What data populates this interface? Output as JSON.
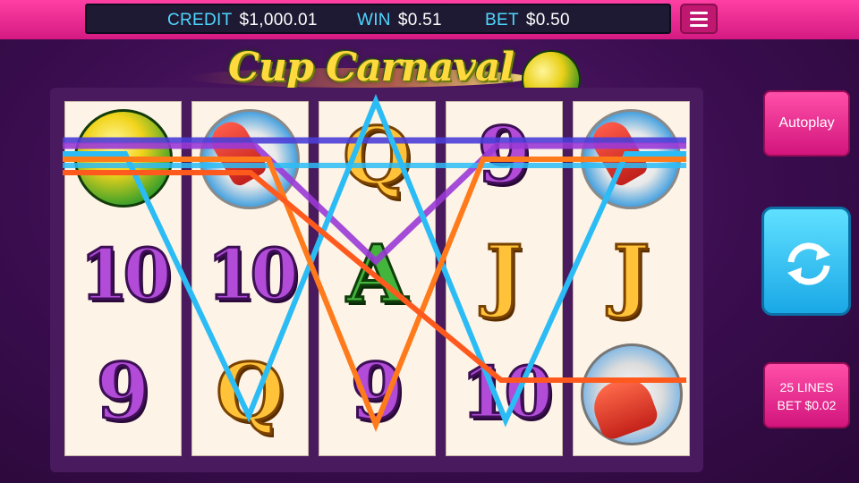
{
  "header": {
    "credit_label": "CREDIT",
    "credit_value": "$1,000.01",
    "win_label": "WIN",
    "win_value": "$0.51",
    "bet_label": "BET",
    "bet_value": "$0.50",
    "menu_icon": "hamburger-menu-icon"
  },
  "game": {
    "title": "Cup Carnaval"
  },
  "reels": [
    {
      "symbols": [
        "soccer-ball",
        "10",
        "9"
      ]
    },
    {
      "symbols": [
        "soccer-boot",
        "10",
        "Q"
      ]
    },
    {
      "symbols": [
        "Q",
        "A",
        "9"
      ]
    },
    {
      "symbols": [
        "9",
        "J",
        "10"
      ]
    },
    {
      "symbols": [
        "soccer-boot",
        "J",
        "goalkeeper-glove"
      ]
    }
  ],
  "symbol_text": {
    "r0c1": "10",
    "r0c2": "9",
    "r1c1": "10",
    "r1c2": "Q",
    "r2c0": "Q",
    "r2c1": "A",
    "r2c2": "9",
    "r3c0": "9",
    "r3c1": "J",
    "r3c2": "10",
    "r4c1": "J"
  },
  "controls": {
    "autoplay_label": "Autoplay",
    "spin_icon": "refresh-arrows-icon",
    "lines_label": "25 LINES",
    "bet_label": "BET $0.02"
  },
  "colors": {
    "accent_pink": "#e0208a",
    "spin_blue": "#2bb8f0",
    "label_cyan": "#4fd7ff",
    "payline_cyan": "#2bbcf5",
    "payline_orange": "#ff7a1a",
    "payline_purple": "#9a3ad6",
    "payline_blue": "#4b3fd8",
    "payline_red_orange": "#ff5a1e"
  }
}
